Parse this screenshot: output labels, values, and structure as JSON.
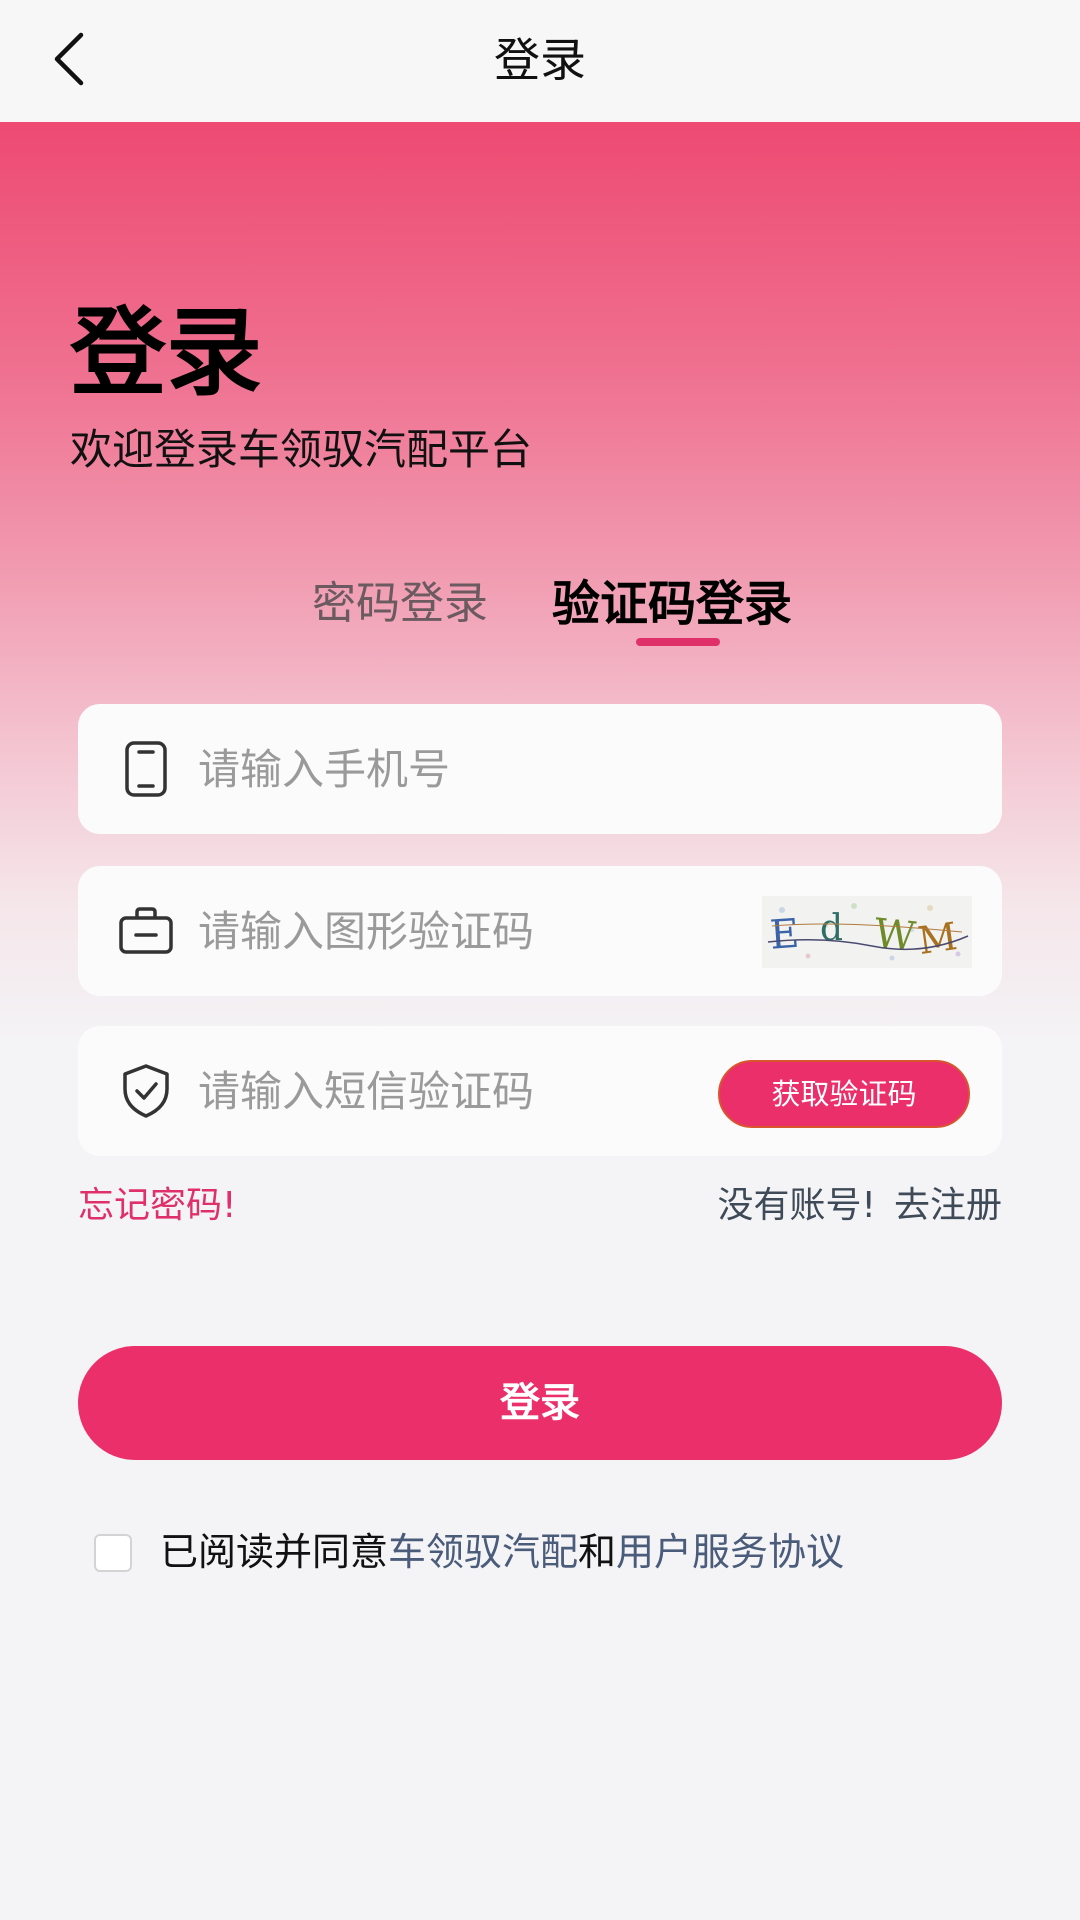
{
  "header": {
    "title": "登录"
  },
  "hero": {
    "title": "登录",
    "subtitle": "欢迎登录车领驭汽配平台"
  },
  "tabs": [
    {
      "label": "密码登录",
      "active": false
    },
    {
      "label": "验证码登录",
      "active": true
    }
  ],
  "form": {
    "phone_placeholder": "请输入手机号",
    "captcha_placeholder": "请输入图形验证码",
    "captcha_text": "EdWM",
    "sms_placeholder": "请输入短信验证码",
    "get_code_label": "获取验证码"
  },
  "links": {
    "forgot": "忘记密码!",
    "no_account": "没有账号!",
    "register": "去注册"
  },
  "login_button": "登录",
  "agreement": {
    "prefix": "已阅读并同意",
    "platform": "车领驭汽配",
    "and": "和",
    "terms": "用户服务协议",
    "checked": false
  },
  "colors": {
    "accent": "#eb2f6a",
    "link": "#4a5c7a",
    "hero_top": "#ee4a72"
  },
  "icons": {
    "back": "back-arrow-icon",
    "phone": "phone-icon",
    "captcha": "briefcase-icon",
    "sms": "shield-check-icon"
  }
}
